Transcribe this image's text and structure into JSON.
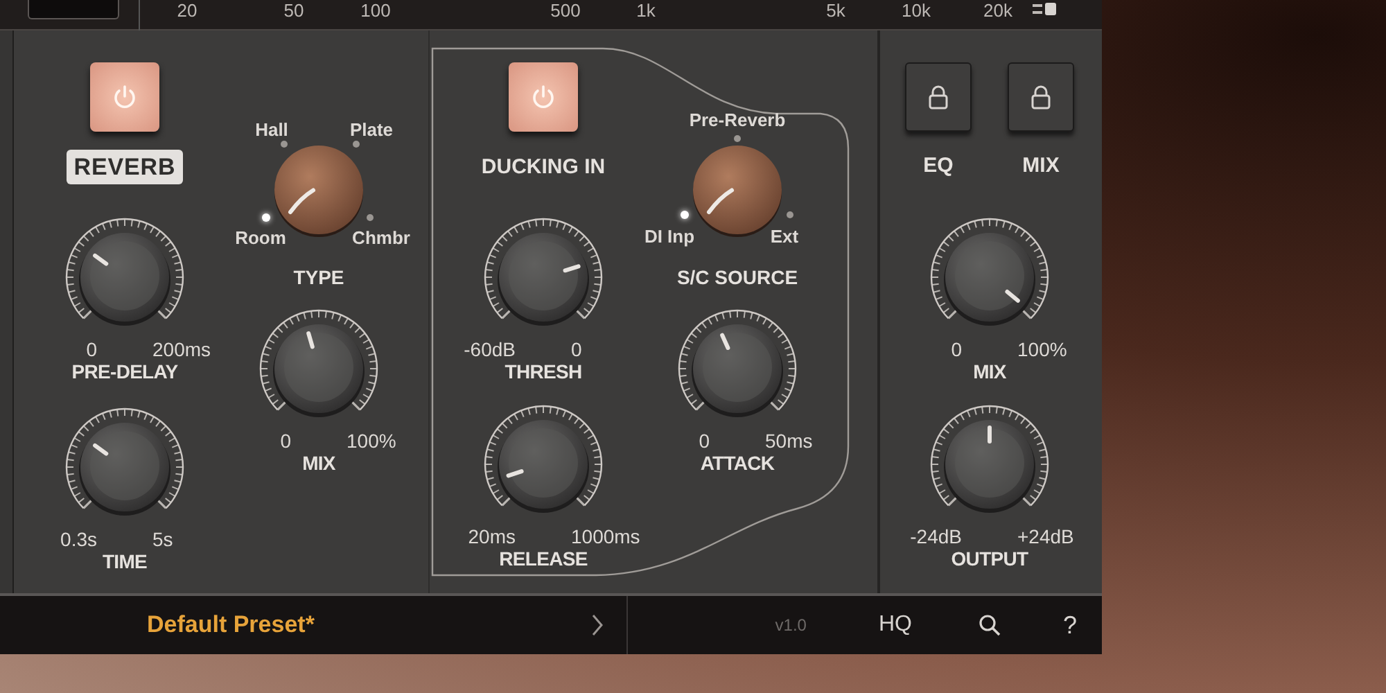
{
  "top_bar": {
    "frequency_labels": [
      "20",
      "50",
      "100",
      "500",
      "1k",
      "5k",
      "10k",
      "20k"
    ]
  },
  "reverb": {
    "title": "REVERB",
    "power": {
      "on": true
    },
    "selector": {
      "label": "TYPE",
      "options": [
        {
          "label": "Hall",
          "selected": false
        },
        {
          "label": "Plate",
          "selected": false
        },
        {
          "label": "Room",
          "selected": true
        },
        {
          "label": "Chmbr",
          "selected": false
        }
      ]
    },
    "knobs": [
      {
        "label": "PRE-DELAY",
        "min": "0",
        "max": "200ms",
        "level": 0.3
      },
      {
        "label": "TIME",
        "min": "0.3s",
        "max": "5s",
        "level": 0.3
      },
      {
        "label": "MIX",
        "min": "0",
        "max": "100%",
        "level": 0.44
      }
    ]
  },
  "ducking": {
    "title": "DUCKING IN",
    "power": {
      "on": true
    },
    "selector": {
      "label": "S/C SOURCE",
      "options": [
        {
          "label": "Pre-Reverb",
          "selected": false
        },
        {
          "label": "**DI** Inp",
          "selected": true
        },
        {
          "label": "Ext",
          "selected": false
        }
      ]
    },
    "knobs": [
      {
        "label": "THRESH",
        "min": "-60dB",
        "max": "0",
        "level": 0.77
      },
      {
        "label": "RELEASE",
        "min": "20ms",
        "max": "1000ms",
        "level": 0.1
      },
      {
        "label": "ATTACK",
        "min": "0",
        "max": "50ms",
        "level": 0.41
      }
    ]
  },
  "output": {
    "locks": [
      {
        "label": "EQ"
      },
      {
        "label": "MIX"
      }
    ],
    "knobs": [
      {
        "label": "MIX",
        "min": "0",
        "max": "100%",
        "level": 0.98
      },
      {
        "label": "OUTPUT",
        "min": "-24dB",
        "max": "+24dB",
        "level": 0.5
      }
    ]
  },
  "footer": {
    "preset": "Default Preset*",
    "version": "v1.0",
    "hq": "HQ",
    "help": "?"
  }
}
